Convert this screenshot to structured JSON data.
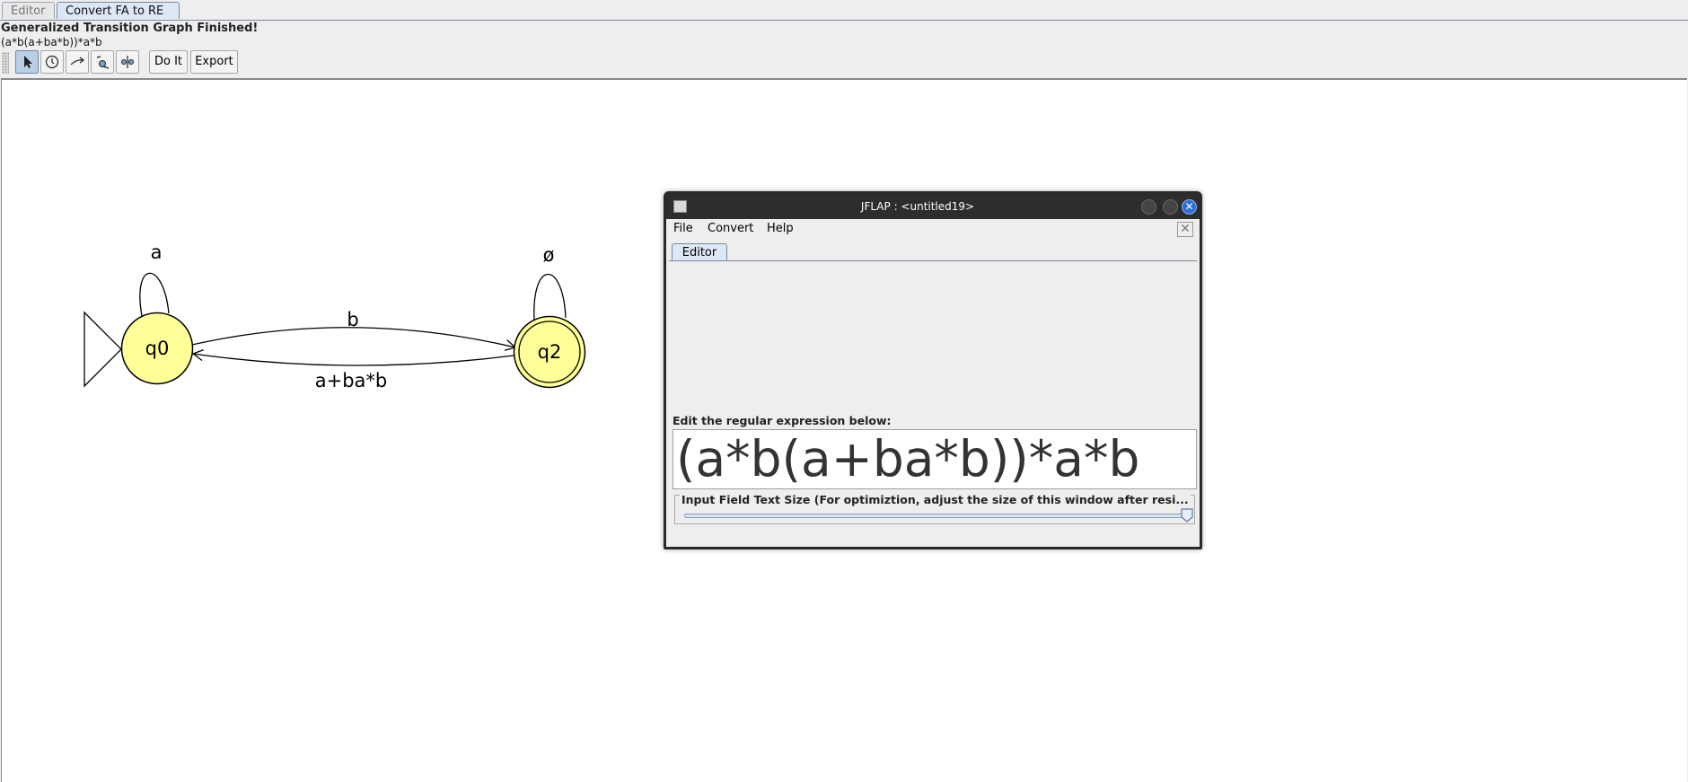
{
  "tabs": [
    {
      "label": "Editor",
      "active": false
    },
    {
      "label": "Convert FA to RE",
      "active": true
    }
  ],
  "status": {
    "message": "Generalized Transition Graph Finished!",
    "expression": "(a*b(a+ba*b))*a*b"
  },
  "toolbar": {
    "tools": [
      "attribute-editor-icon",
      "state-creator-icon",
      "transition-creator-icon",
      "collapse-transitions-icon",
      "collapse-states-icon"
    ],
    "do_it_label": "Do It",
    "export_label": "Export"
  },
  "automaton": {
    "state_fill": "#ffff99",
    "states": [
      {
        "id": "q0",
        "label": "q0",
        "initial": true,
        "final": false
      },
      {
        "id": "q2",
        "label": "q2",
        "initial": false,
        "final": true
      }
    ],
    "transitions": [
      {
        "from": "q0",
        "to": "q0",
        "label": "a"
      },
      {
        "from": "q0",
        "to": "q2",
        "label": "b"
      },
      {
        "from": "q2",
        "to": "q0",
        "label": "a+ba*b"
      },
      {
        "from": "q2",
        "to": "q2",
        "label": "ø"
      }
    ]
  },
  "dialog": {
    "title": "JFLAP : <untitled19>",
    "menu": [
      "File",
      "Convert",
      "Help"
    ],
    "tab": "Editor",
    "edit_label": "Edit the regular expression below:",
    "regex_value": "(a*b(a+ba*b))*a*b",
    "slider_label": "Input Field Text Size (For optimiztion, adjust the size of this window after resi...",
    "slider_value_fraction": 1.0
  },
  "colors": {
    "accent": "#2f6fd6",
    "tab_active": "#dce8f5"
  }
}
